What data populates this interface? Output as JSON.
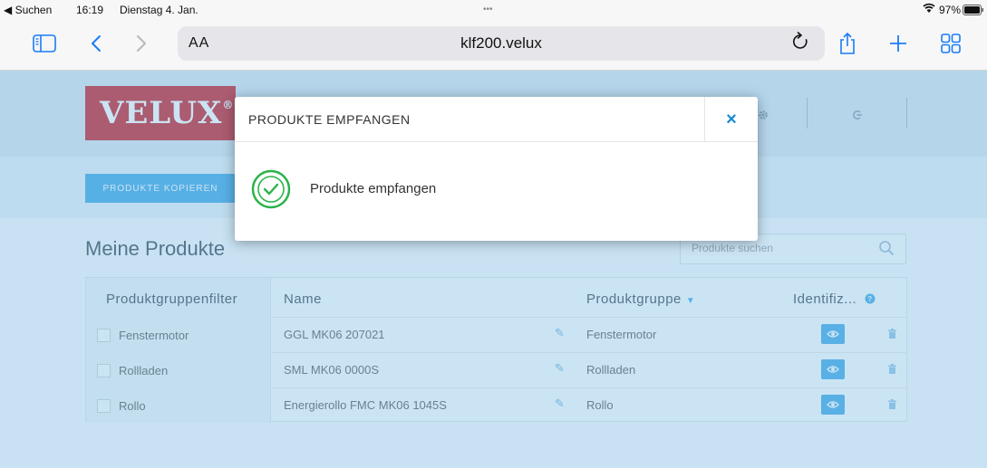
{
  "status_bar": {
    "back_app": "◀ Suchen",
    "time": "16:19",
    "date": "Dienstag 4. Jan.",
    "multitask_dots": "•••",
    "battery": "97%"
  },
  "browser": {
    "text_size_label": "AA",
    "url": "klf200.velux",
    "icons": [
      "sidebar-icon",
      "back-icon",
      "forward-icon",
      "reload-icon",
      "share-icon",
      "new-tab-icon",
      "tabs-overview-icon"
    ]
  },
  "page": {
    "logo_text": "VELUX",
    "logo_mark": "®",
    "copy_button": "PRODUKTE KOPIEREN",
    "title": "Meine Produkte",
    "search_placeholder": "Produkte suchen",
    "filter_header": "Produktgruppenfilter",
    "filters": [
      "Fenstermotor",
      "Rollladen",
      "Rollo"
    ],
    "columns": {
      "name": "Name",
      "group": "Produktgruppe",
      "identify": "Identifiz..."
    },
    "rows": [
      {
        "name": "GGL MK06 207021",
        "group": "Fenstermotor"
      },
      {
        "name": "SML MK06 0000S",
        "group": "Rollladen"
      },
      {
        "name": "Energierollo FMC MK06 1045S",
        "group": "Rollo"
      }
    ]
  },
  "modal": {
    "title": "PRODUKTE EMPFANGEN",
    "close": "×",
    "message": "Produkte empfangen"
  },
  "colors": {
    "accent": "#38a5e6",
    "logo": "#c8161d",
    "success": "#2bb34a"
  }
}
